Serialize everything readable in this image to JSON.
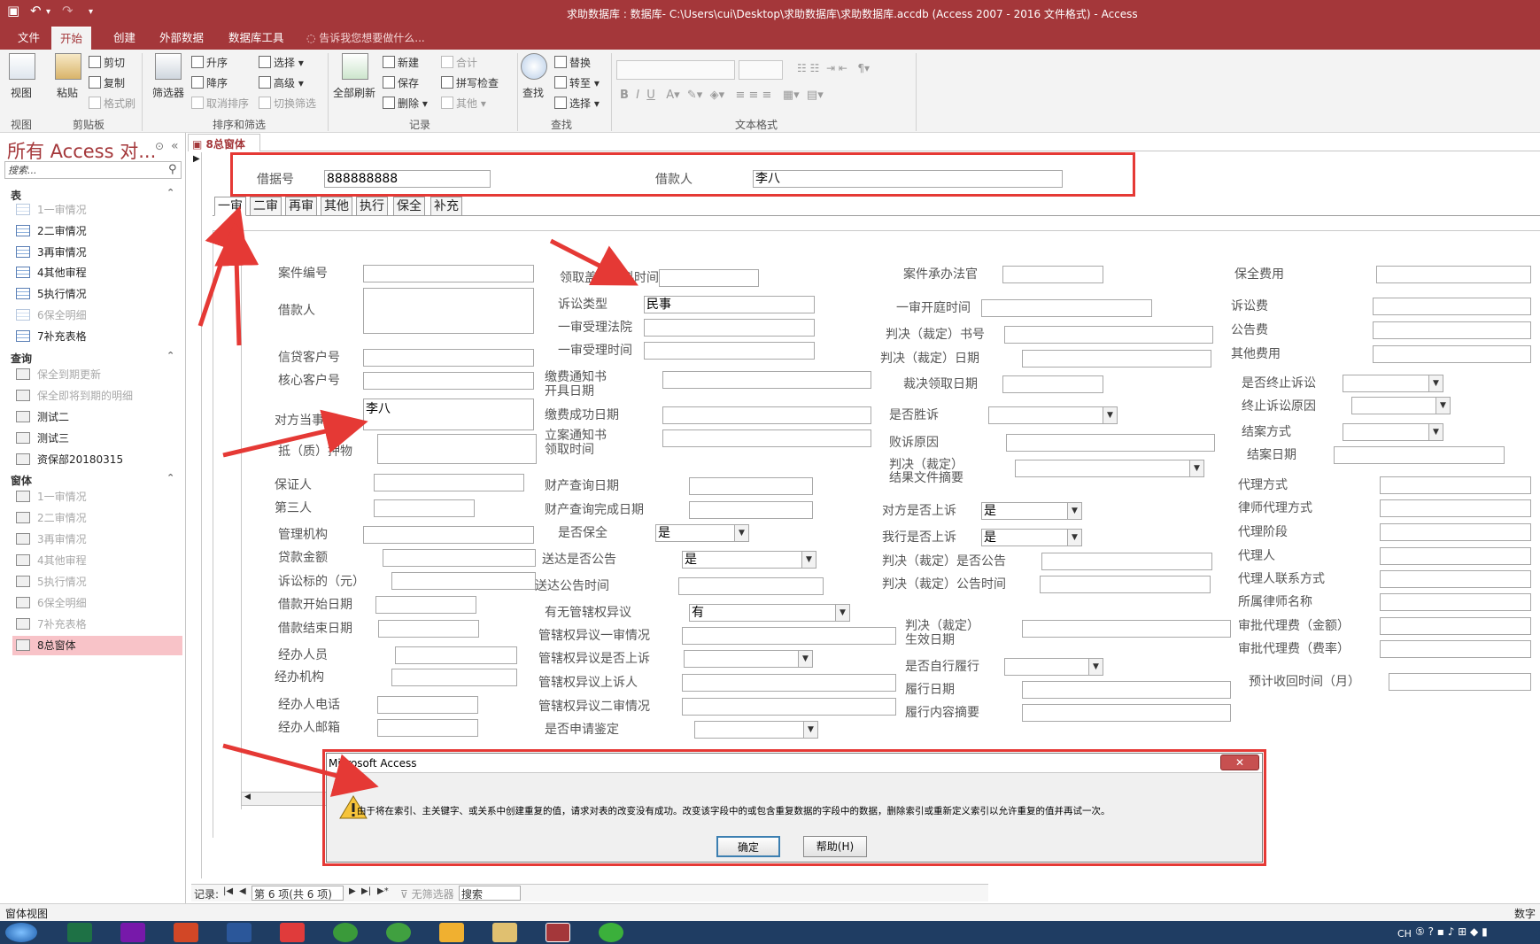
{
  "app": {
    "title": "求助数据库 : 数据库- C:\\Users\\cui\\Desktop\\求助数据库\\求助数据库.accdb (Access 2007 - 2016 文件格式) - Access",
    "tabs": [
      "文件",
      "开始",
      "创建",
      "外部数据",
      "数据库工具"
    ],
    "tell_me": "告诉我您想要做什么..."
  },
  "ribbon": {
    "view_label": "视图",
    "paste_label": "粘贴",
    "cut": "剪切",
    "copy": "复制",
    "format_painter": "格式刷",
    "filter": "筛选器",
    "asc": "升序",
    "desc": "降序",
    "remove_sort": "取消排序",
    "selection": "选择",
    "advanced": "高级",
    "toggle_filter": "切换筛选",
    "refresh_all": "全部刷新",
    "new": "新建",
    "save": "保存",
    "delete": "删除",
    "totals": "合计",
    "spelling": "拼写检查",
    "more": "其他",
    "find": "查找",
    "replace": "替换",
    "goto": "转至",
    "select": "选择",
    "groups": {
      "view": "视图",
      "clipboard": "剪贴板",
      "sort_filter": "排序和筛选",
      "records": "记录",
      "find": "查找",
      "text_format": "文本格式"
    }
  },
  "nav": {
    "title": "所有 Access 对...",
    "search_placeholder": "搜索...",
    "categories": {
      "tables": "表",
      "queries": "查询",
      "forms": "窗体"
    },
    "tables": [
      "1一审情况",
      "2二审情况",
      "3再审情况",
      "4其他审程",
      "5执行情况",
      "6保全明细",
      "7补充表格"
    ],
    "queries": [
      "保全到期更新",
      "保全即将到期的明细",
      "测试二",
      "测试三",
      "资保部20180315"
    ],
    "forms": [
      "1一审情况",
      "2二审情况",
      "3再审情况",
      "4其他审程",
      "5执行情况",
      "6保全明细",
      "7补充表格",
      "8总窗体"
    ]
  },
  "doc": {
    "tab_label": "8总窗体"
  },
  "form": {
    "header": {
      "receipt_no_label": "借据号",
      "receipt_no": "888888888",
      "borrower_label": "借款人",
      "borrower": "李八"
    },
    "tabs": [
      "一审",
      "二审",
      "再审",
      "其他",
      "执行",
      "保全",
      "补充"
    ],
    "col1": {
      "case_no": "案件编号",
      "borrower": "借款人",
      "credit_cust_no": "信贷客户号",
      "core_cust_no": "核心客户号",
      "opposite_party": "对方当事人",
      "opposite_party_value": "李八",
      "pledge": "抵（质）押物",
      "guarantor": "保证人",
      "third_party": "第三人",
      "mgmt_org": "管理机构",
      "loan_amount": "贷款金额",
      "claim_amount": "诉讼标的（元）",
      "loan_start": "借款开始日期",
      "loan_end": "借款结束日期",
      "handler": "经办人员",
      "handler_org": "经办机构",
      "handler_phone": "经办人电话",
      "handler_email": "经办人邮箱"
    },
    "col2": {
      "seal_time": "领取盖章材料时间",
      "lawsuit_type": "诉讼类型",
      "lawsuit_type_value": "民事",
      "court": "一审受理法院",
      "accept_time": "一审受理时间",
      "fee_notice_l1": "缴费通知书",
      "fee_notice_l2": "开具日期",
      "fee_paid": "缴费成功日期",
      "filing_notice_l1": "立案通知书",
      "filing_notice_l2": "领取时间",
      "prop_query": "财产查询日期",
      "prop_query_done": "财产查询完成日期",
      "preserve": "是否保全",
      "preserve_value": "是",
      "announce": "送达是否公告",
      "announce_value": "是",
      "announce_time": "送达公告时间",
      "jurisdiction": "有无管辖权异议",
      "jurisdiction_value": "有",
      "jur_first": "管辖权异议一审情况",
      "jur_appeal": "管辖权异议是否上诉",
      "jur_appellant": "管辖权异议上诉人",
      "jur_second": "管辖权异议二审情况",
      "appraisal": "是否申请鉴定"
    },
    "col3": {
      "judge": "案件承办法官",
      "hearing": "一审开庭时间",
      "verdict_no": "判决（裁定）书号",
      "verdict_date": "判决（裁定）日期",
      "verdict_collect": "裁决领取日期",
      "won": "是否胜诉",
      "lose_reason": "败诉原因",
      "summary_l1": "判决（裁定）",
      "summary_l2": "结果文件摘要",
      "opp_appeal": "对方是否上诉",
      "opp_appeal_value": "是",
      "our_appeal": "我行是否上诉",
      "our_appeal_value": "是",
      "verdict_announce": "判决（裁定）是否公告",
      "verdict_announce_time": "判决（裁定）公告时间",
      "effective_l1": "判决（裁定）",
      "effective_l2": "生效日期",
      "self_perform": "是否自行履行",
      "perform_date": "履行日期",
      "perform_summary": "履行内容摘要"
    },
    "col4": {
      "preserve_fee": "保全费用",
      "lawsuit_fee": "诉讼费",
      "announce_fee": "公告费",
      "other_fee": "其他费用",
      "terminated": "是否终止诉讼",
      "terminate_reason": "终止诉讼原因",
      "close_method": "结案方式",
      "close_date": "结案日期",
      "agent_method": "代理方式",
      "lawyer_method": "律师代理方式",
      "agent_stage": "代理阶段",
      "agent": "代理人",
      "agent_contact": "代理人联系方式",
      "law_firm": "所属律师名称",
      "approve_fee_amt": "审批代理费（金额）",
      "approve_fee_rate": "审批代理费（费率）",
      "expected_recovery": "预计收回时间（月）"
    }
  },
  "recnav": {
    "label": "记录:",
    "position": "第 6 项(共 6 项)",
    "filter": "无筛选器",
    "search": "搜索"
  },
  "status": {
    "left": "窗体视图",
    "right": "数字"
  },
  "dialog": {
    "title": "Microsoft Access",
    "message": "由于将在索引、主关键字、或关系中创建重复的值，请求对表的改变没有成功。改变该字段中的或包含重复数据的字段中的数据，删除索引或重新定义索引以允许重复的值并再试一次。",
    "ok": "确定",
    "help": "帮助(H)"
  },
  "taskbar": {
    "ime": "CH"
  },
  "colors": {
    "accent": "#a4373a",
    "annotation": "#e53935"
  }
}
